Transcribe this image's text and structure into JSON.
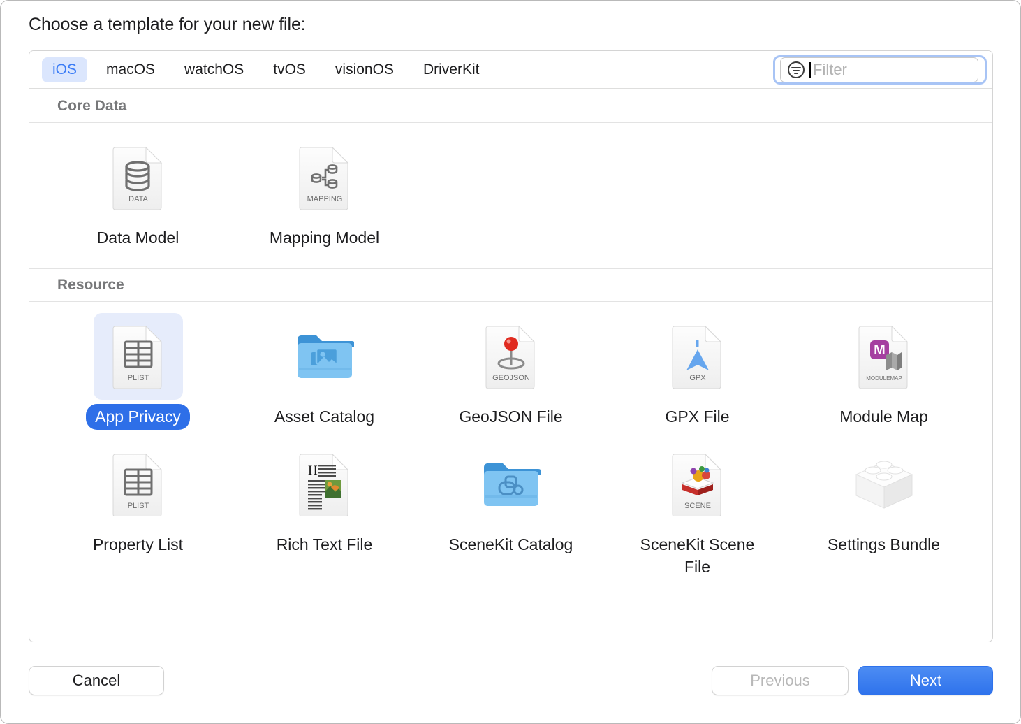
{
  "dialog": {
    "prompt": "Choose a template for your new file:"
  },
  "tabs": [
    {
      "label": "iOS",
      "active": true
    },
    {
      "label": "macOS",
      "active": false
    },
    {
      "label": "watchOS",
      "active": false
    },
    {
      "label": "tvOS",
      "active": false
    },
    {
      "label": "visionOS",
      "active": false
    },
    {
      "label": "DriverKit",
      "active": false
    }
  ],
  "filter": {
    "icon": "filter-circle-icon",
    "value": "",
    "placeholder": "Filter",
    "focused": true,
    "focus_ring_color": "#a8c4f5"
  },
  "sections": [
    {
      "title": "Core Data",
      "items": [
        {
          "label": "Data Model",
          "icon": "document-data-icon",
          "badge": "DATA",
          "selected": false
        },
        {
          "label": "Mapping Model",
          "icon": "document-mapping-icon",
          "badge": "MAPPING",
          "selected": false
        }
      ]
    },
    {
      "title": "Resource",
      "items": [
        {
          "label": "App Privacy",
          "icon": "document-plist-icon",
          "badge": "PLIST",
          "selected": true
        },
        {
          "label": "Asset Catalog",
          "icon": "folder-assets-icon",
          "badge": "",
          "selected": false
        },
        {
          "label": "GeoJSON File",
          "icon": "document-geojson-icon",
          "badge": "GEOJSON",
          "selected": false
        },
        {
          "label": "GPX File",
          "icon": "document-gpx-icon",
          "badge": "GPX",
          "selected": false
        },
        {
          "label": "Module Map",
          "icon": "document-modulemap-icon",
          "badge": "MODULEMAP",
          "selected": false
        },
        {
          "label": "Property List",
          "icon": "document-plist-icon",
          "badge": "PLIST",
          "selected": false
        },
        {
          "label": "Rich Text File",
          "icon": "document-richtext-icon",
          "badge": "",
          "selected": false
        },
        {
          "label": "SceneKit Catalog",
          "icon": "folder-scenekit-icon",
          "badge": "",
          "selected": false
        },
        {
          "label": "SceneKit Scene File",
          "icon": "document-scene-icon",
          "badge": "SCENE",
          "selected": false
        },
        {
          "label": "Settings Bundle",
          "icon": "bundle-brick-icon",
          "badge": "",
          "selected": false
        }
      ]
    }
  ],
  "footer": {
    "cancel_label": "Cancel",
    "previous_label": "Previous",
    "previous_disabled": true,
    "next_label": "Next",
    "next_accent": "#2e72ec"
  }
}
